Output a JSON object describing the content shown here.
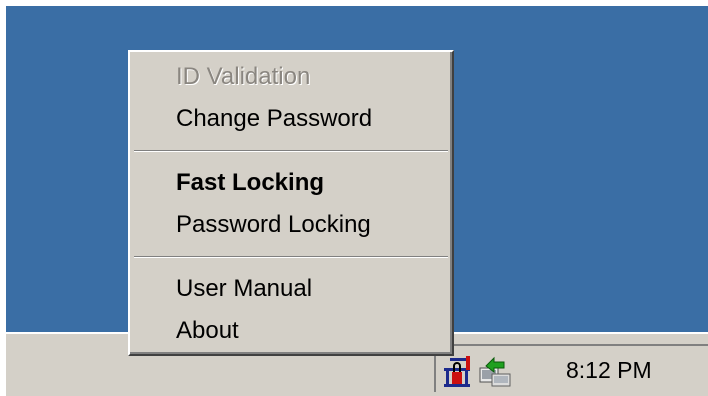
{
  "menu": {
    "items": [
      {
        "label": "ID Validation",
        "state": "disabled"
      },
      {
        "label": "Change Password",
        "state": "enabled"
      },
      {
        "label": "Fast Locking",
        "state": "default"
      },
      {
        "label": "Password Locking",
        "state": "enabled"
      },
      {
        "label": "User Manual",
        "state": "enabled"
      },
      {
        "label": "About",
        "state": "enabled"
      }
    ]
  },
  "tray": {
    "icons": [
      "lock-app-icon",
      "network-connection-icon"
    ],
    "clock": "8:12 PM"
  },
  "colors": {
    "desktop": "#3a6ea5",
    "surface": "#d4d0c8",
    "disabled_text": "#8a8680"
  }
}
